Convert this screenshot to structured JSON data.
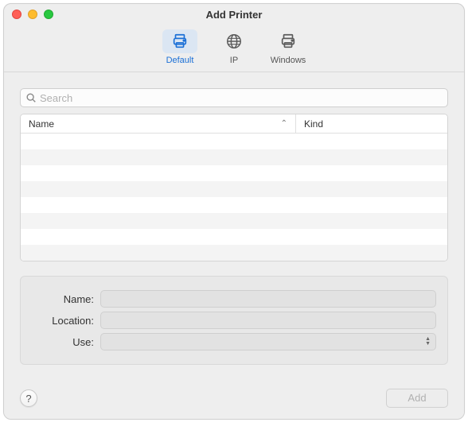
{
  "window": {
    "title": "Add Printer"
  },
  "toolbar": {
    "tabs": [
      {
        "id": "default",
        "label": "Default",
        "icon": "printer-icon",
        "selected": true
      },
      {
        "id": "ip",
        "label": "IP",
        "icon": "globe-icon",
        "selected": false
      },
      {
        "id": "windows",
        "label": "Windows",
        "icon": "printer-icon",
        "selected": false
      }
    ]
  },
  "search": {
    "placeholder": "Search",
    "value": ""
  },
  "table": {
    "columns": [
      {
        "id": "name",
        "label": "Name",
        "sort": "asc"
      },
      {
        "id": "kind",
        "label": "Kind"
      }
    ],
    "rows": []
  },
  "form": {
    "name": {
      "label": "Name:",
      "value": ""
    },
    "location": {
      "label": "Location:",
      "value": ""
    },
    "use": {
      "label": "Use:",
      "value": ""
    }
  },
  "footer": {
    "help_tooltip": "?",
    "add_label": "Add",
    "add_enabled": false
  }
}
